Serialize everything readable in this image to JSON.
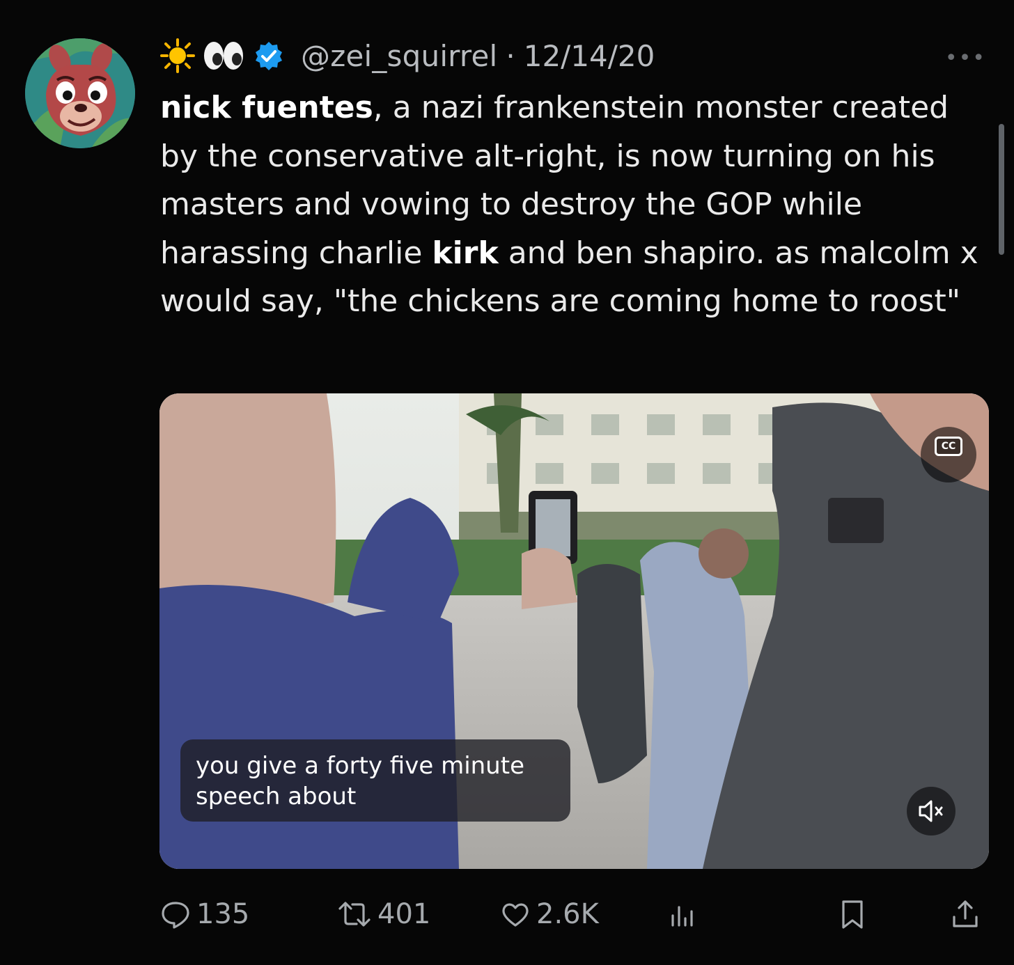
{
  "author": {
    "emoji_1": "sun-emoji",
    "emoji_2": "eyes-emoji",
    "verified": true,
    "handle": "@zei_squirrel",
    "separator": "·",
    "date": "12/14/20"
  },
  "tweet": {
    "part1_bold": "nick fuentes",
    "part2": ", a nazi frankenstein monster created by the conservative alt-right, is now turning on his masters and vowing to destroy the GOP while harassing charlie ",
    "part3_bold": "kirk",
    "part4": " and ben shapiro. as malcolm x would say, \"the chickens are coming home to roost\""
  },
  "video": {
    "cc_label": "CC",
    "caption_line1": "you give a forty five minute",
    "caption_line2": "speech about"
  },
  "actions": {
    "replies": "135",
    "reposts": "401",
    "likes": "2.6K"
  },
  "colors": {
    "accent": "#1d9bf0",
    "muted_text": "#a6aaae",
    "background": "#060606"
  }
}
